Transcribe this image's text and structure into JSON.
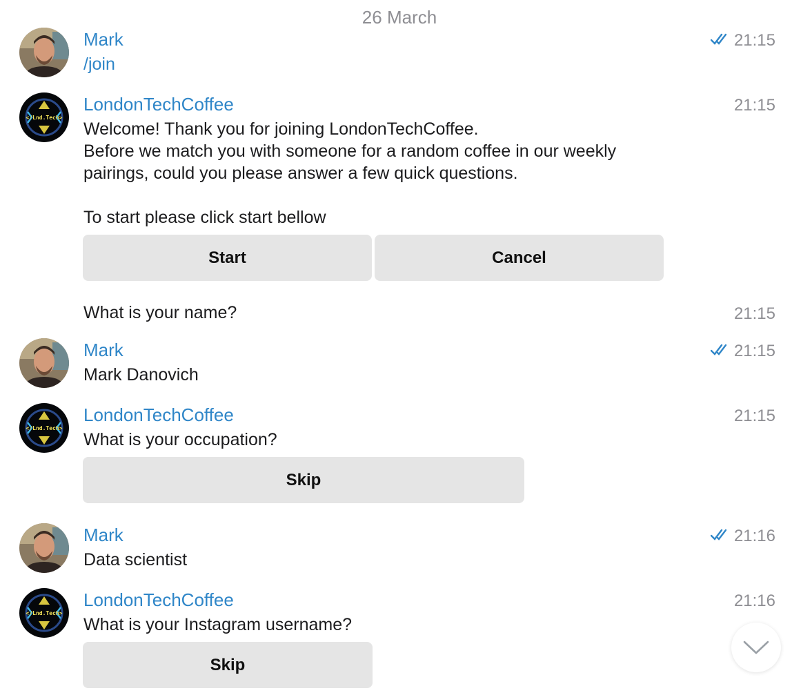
{
  "date_separator": "26 March",
  "messages": [
    {
      "sender": "Mark",
      "text": "/join",
      "time": "21:15",
      "read": true
    },
    {
      "sender": "LondonTechCoffee",
      "lines": [
        "Welcome! Thank you for joining LondonTechCoffee.",
        "Before we match you with someone for a random coffee in our weekly",
        "pairings, could you please answer a few quick questions.",
        "To start please click start bellow"
      ],
      "time": "21:15",
      "buttons": [
        "Start",
        "Cancel"
      ]
    },
    {
      "text": "What is your name?",
      "time": "21:15"
    },
    {
      "sender": "Mark",
      "text": "Mark Danovich",
      "time": "21:15",
      "read": true
    },
    {
      "sender": "LondonTechCoffee",
      "text": "What is your occupation?",
      "time": "21:15",
      "buttons": [
        "Skip"
      ]
    },
    {
      "sender": "Mark",
      "text": "Data scientist",
      "time": "21:16",
      "read": true
    },
    {
      "sender": "LondonTechCoffee",
      "text": "What is your Instagram username?",
      "time": "21:16",
      "buttons": [
        "Skip"
      ]
    }
  ],
  "avatar_text": "</Lnd.Tech>",
  "icons": {
    "read_receipt": "double-check-icon",
    "scroll_down": "chevron-down-icon"
  },
  "colors": {
    "accent": "#2f86c8",
    "button_bg": "#e5e5e5",
    "timestamp": "#8e8e93"
  }
}
